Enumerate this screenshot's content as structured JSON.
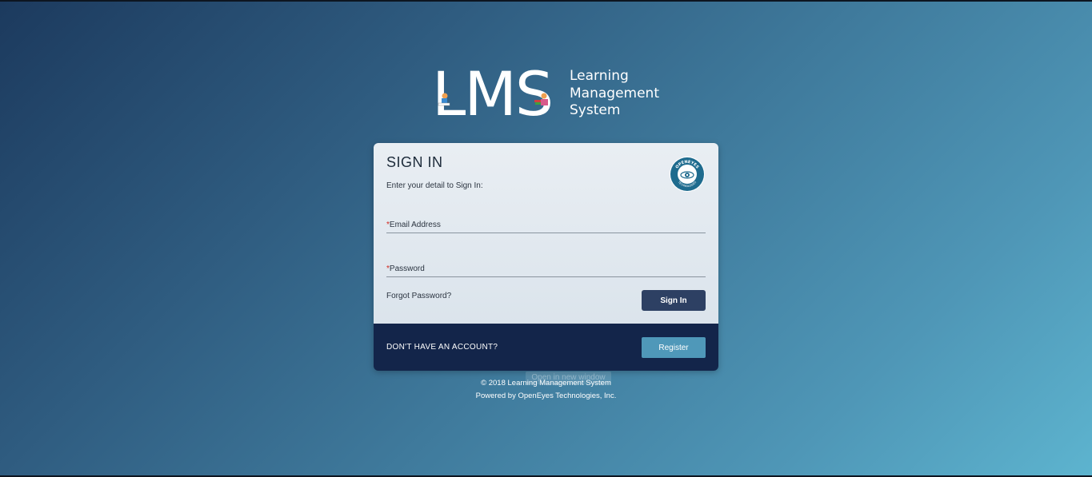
{
  "logo": {
    "mark": "LMS",
    "line1": "Learning",
    "line2": "Management",
    "line3": "System"
  },
  "card": {
    "title": "SIGN IN",
    "subtitle": "Enter your detail to Sign In:",
    "badge_name": "OPENEYES",
    "badge_sub": "TECHNOLOGIES",
    "email_label": "Email Address",
    "password_label": "Password",
    "required_mark": "*",
    "forgot": "Forgot Password?",
    "signin_button": "Sign In",
    "noaccount": "DON'T HAVE AN ACCOUNT?",
    "register_button": "Register"
  },
  "overlay": "Open in new window",
  "footer": {
    "copyright": "© 2018 Learning Management System",
    "powered": "Powered by OpenEyes Technologies, Inc."
  },
  "colors": {
    "bg_start": "#1c3a5e",
    "bg_end": "#5db4cf",
    "primary_button": "#2d4063",
    "register_button": "#4f98b9",
    "footer_band": "#13254a",
    "required": "#d0261e"
  }
}
